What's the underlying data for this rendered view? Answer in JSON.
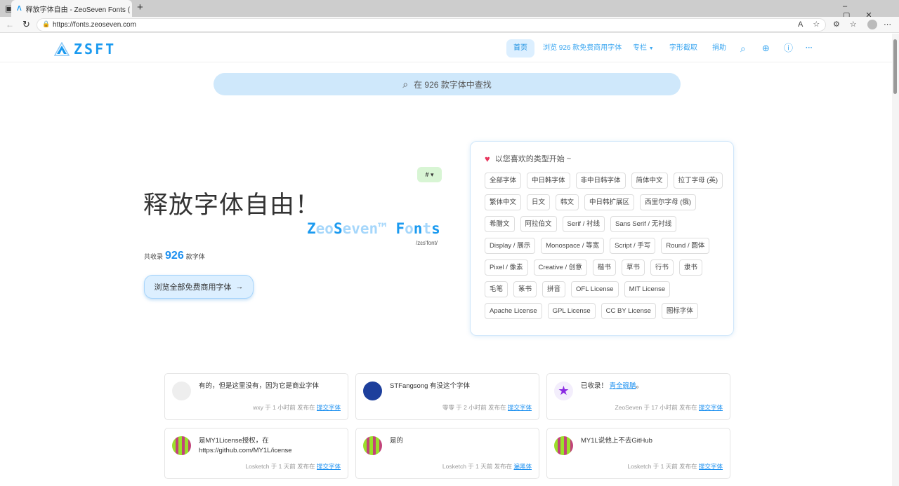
{
  "browser": {
    "tab_title": "释放字体自由 - ZeoSeven Fonts (",
    "url": "https://fonts.zeoseven.com"
  },
  "nav": {
    "logo": "ZSFT",
    "items": [
      "首页",
      "浏览 926 款免费商用字体",
      "专栏",
      "字形截取",
      "捐助"
    ]
  },
  "search": {
    "placeholder": "在 926 款字体中查找"
  },
  "hero": {
    "title": "释放字体自由！",
    "hash": "#",
    "brand_parts": [
      "Z",
      "eo",
      "S",
      "even™ ",
      "F",
      "o",
      "n",
      "t",
      "s"
    ],
    "pronunciation": "/zɛs'font/",
    "count_prefix": "共收录",
    "count": "926",
    "count_suffix": "款字体",
    "browse_button": "浏览全部免费商用字体"
  },
  "panel": {
    "heading": "以您喜欢的类型开始 ~",
    "rows": [
      [
        "全部字体",
        "中日韩字体",
        "非中日韩字体",
        "简体中文",
        "拉丁字母 (英)"
      ],
      [
        "繁体中文",
        "日文",
        "韩文",
        "中日韩扩展区",
        "西里尔字母 (俄)"
      ],
      [
        "希腊文",
        "阿拉伯文",
        "Serif / 衬线",
        "Sans Serif / 无衬线"
      ],
      [
        "Display / 展示",
        "Monospace / 等宽",
        "Script / 手写",
        "Round / 圆体"
      ],
      [
        "Pixel / 像素",
        "Creative / 创意",
        "楷书",
        "草书",
        "行书",
        "隶书"
      ],
      [
        "毛笔",
        "篆书",
        "拼音",
        "OFL License",
        "MIT License"
      ],
      [
        "Apache License",
        "GPL License",
        "CC BY License",
        "图标字体"
      ]
    ]
  },
  "comments": [
    {
      "text": "有的，但是这里没有，因为它是商业字体",
      "link_text": "",
      "meta": "wxy 于 1 小时前 发布在",
      "where": "提交字体"
    },
    {
      "text": "STFangsong 有没这个字体",
      "link_text": "",
      "meta": "零零 于 2 小时前 发布在",
      "where": "提交字体"
    },
    {
      "text": "已收录！",
      "link_text": "青全碗膳",
      "meta": "ZeoSeven 于 17 小时前 发布在",
      "where": "提交字体"
    },
    {
      "text": "是MY1License授权，在https://github.com/MY1L/icense",
      "link_text": "",
      "meta": "Losketch 于 1 天前 发布在",
      "where": "提交字体"
    },
    {
      "text": "是的",
      "link_text": "",
      "meta": "Losketch 于 1 天前 发布在",
      "where": "遍黑体"
    },
    {
      "text": "MY1L说他上不去GitHub",
      "link_text": "",
      "meta": "Losketch 于 1 天前 发布在",
      "where": "提交字体"
    }
  ],
  "colors": {
    "accent": "#1a9af0",
    "search_bg": "#cfe8fb"
  }
}
